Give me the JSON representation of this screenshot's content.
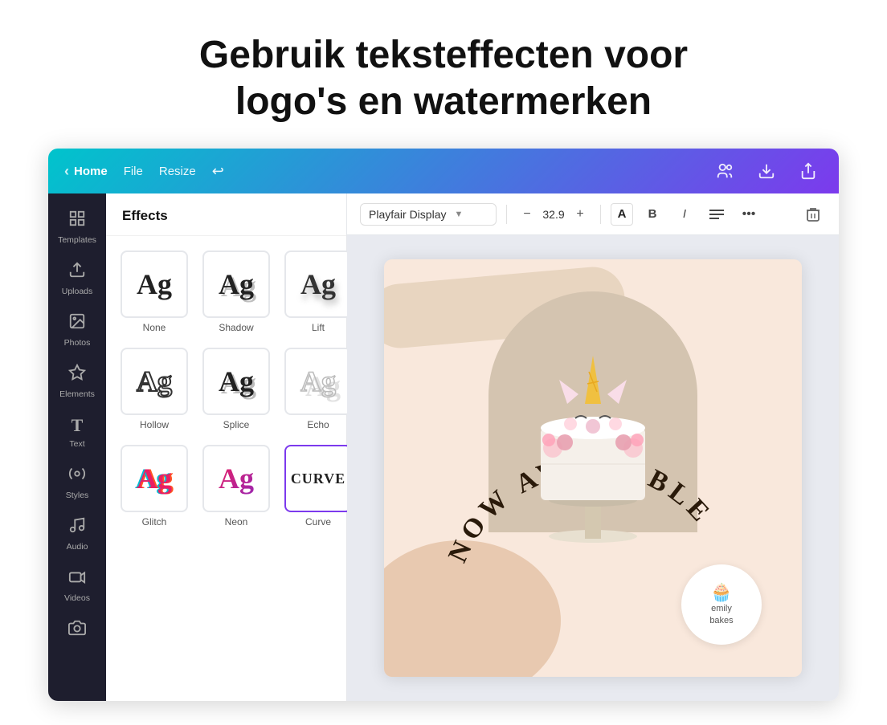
{
  "page": {
    "header": {
      "line1": "Gebruik teksteffecten voor",
      "line2": "logo's en watermerken"
    }
  },
  "topnav": {
    "home_label": "Home",
    "file_label": "File",
    "resize_label": "Resize"
  },
  "sidebar": {
    "items": [
      {
        "id": "templates",
        "icon": "⊞",
        "label": "Templates"
      },
      {
        "id": "uploads",
        "icon": "↑",
        "label": "Uploads"
      },
      {
        "id": "photos",
        "icon": "🖼",
        "label": "Photos"
      },
      {
        "id": "elements",
        "icon": "✦",
        "label": "Elements"
      },
      {
        "id": "text",
        "icon": "T",
        "label": "Text"
      },
      {
        "id": "styles",
        "icon": "◎",
        "label": "Styles"
      },
      {
        "id": "audio",
        "icon": "♪",
        "label": "Audio"
      },
      {
        "id": "videos",
        "icon": "▶",
        "label": "Videos"
      },
      {
        "id": "camera",
        "icon": "📷",
        "label": ""
      }
    ]
  },
  "effects": {
    "title": "Effects",
    "items": [
      {
        "id": "none",
        "label": "None",
        "text": "Ag",
        "style": "none"
      },
      {
        "id": "shadow",
        "label": "Shadow",
        "text": "Ag",
        "style": "shadow"
      },
      {
        "id": "lift",
        "label": "Lift",
        "text": "Ag",
        "style": "lift"
      },
      {
        "id": "hollow",
        "label": "Hollow",
        "text": "Ag",
        "style": "hollow"
      },
      {
        "id": "splice",
        "label": "Splice",
        "text": "Ag",
        "style": "splice"
      },
      {
        "id": "echo",
        "label": "Echo",
        "text": "Ag",
        "style": "echo"
      },
      {
        "id": "glitch",
        "label": "Glitch",
        "text": "Ag",
        "style": "glitch"
      },
      {
        "id": "neon",
        "label": "Neon",
        "text": "Ag",
        "style": "neon"
      },
      {
        "id": "curve",
        "label": "Curve",
        "text": "CURVE",
        "style": "curve",
        "selected": true
      }
    ]
  },
  "toolbar": {
    "font_name": "Playfair Display",
    "font_size": "32.9",
    "color_char": "A",
    "bold_char": "B",
    "italic_char": "I",
    "align_char": "≡",
    "more_char": "•••",
    "minus": "−",
    "plus": "+"
  },
  "canvas": {
    "arc_text": "NOW AVAILABLE",
    "logo_icon": "🧁",
    "logo_line1": "emily",
    "logo_line2": "bakes"
  }
}
